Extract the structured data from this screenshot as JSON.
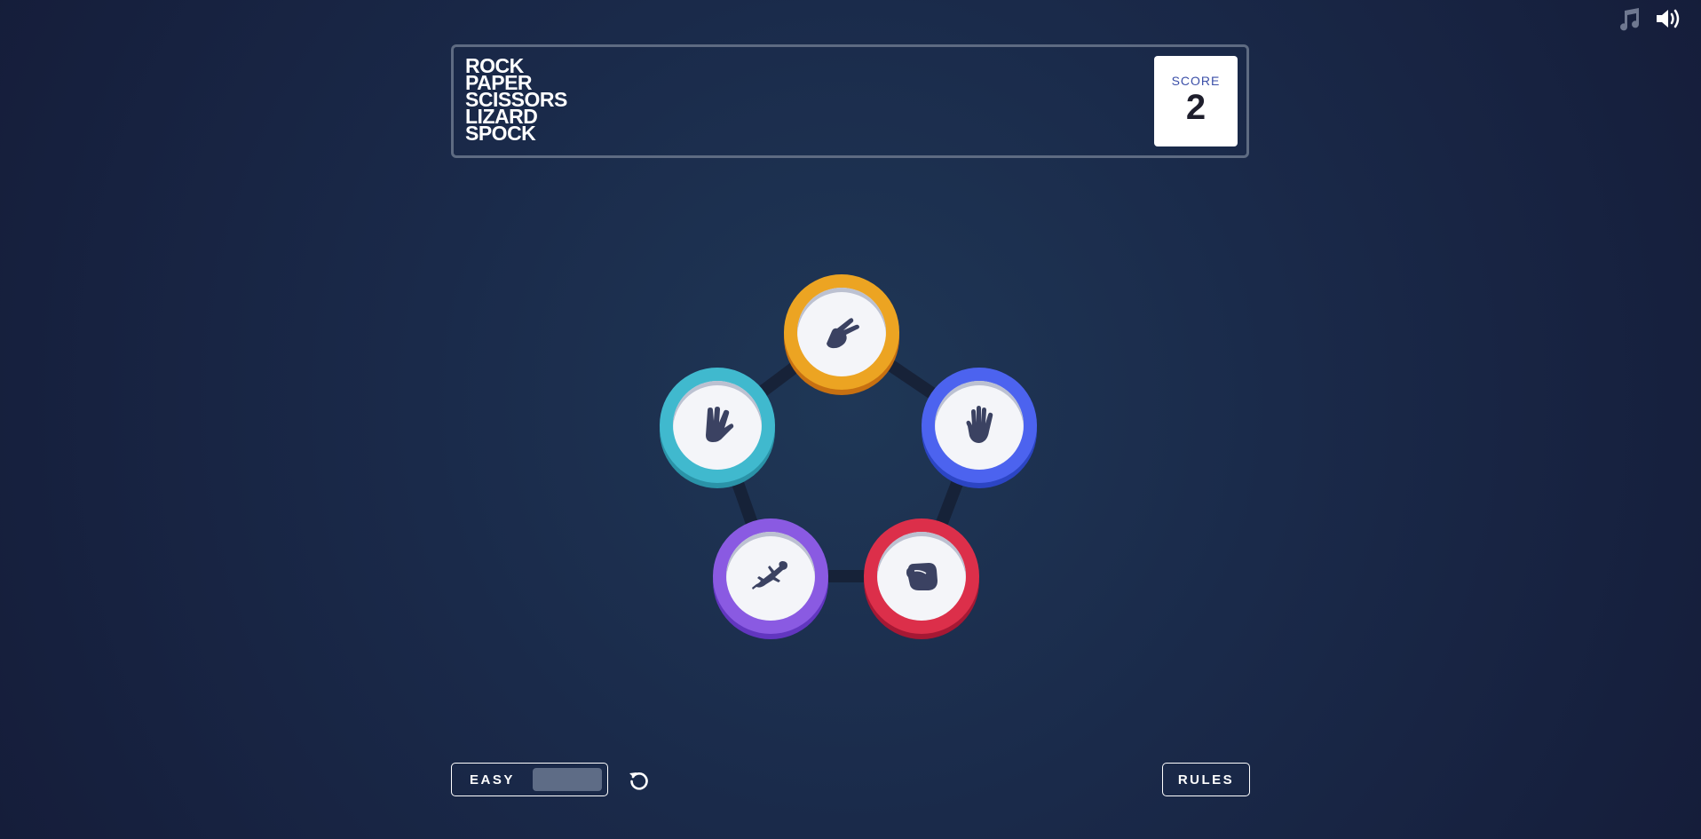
{
  "header": {
    "title_lines": [
      "ROCK",
      "PAPER",
      "SCISSORS",
      "LIZARD",
      "SPOCK"
    ],
    "score_label": "SCORE",
    "score_value": "2"
  },
  "top_icons": [
    "music-note-icon",
    "speaker-volume-icon"
  ],
  "tokens": [
    {
      "name": "scissors",
      "color": "#eca422",
      "icon": "scissors-hand-icon"
    },
    {
      "name": "paper",
      "color": "#4c63ef",
      "icon": "open-hand-icon"
    },
    {
      "name": "rock",
      "color": "#dc2f4a",
      "icon": "fist-icon"
    },
    {
      "name": "lizard",
      "color": "#8a5ae2",
      "icon": "lizard-icon"
    },
    {
      "name": "spock",
      "color": "#40b9ce",
      "icon": "vulcan-salute-icon"
    }
  ],
  "controls": {
    "mode_label": "EASY",
    "rules_label": "RULES",
    "reset_icon": "reset-icon"
  },
  "colors": {
    "background": "#1a2a4a",
    "header_border": "#5e6b82",
    "score_label": "#3b4fa8",
    "icon_fill": "#3b4262"
  }
}
